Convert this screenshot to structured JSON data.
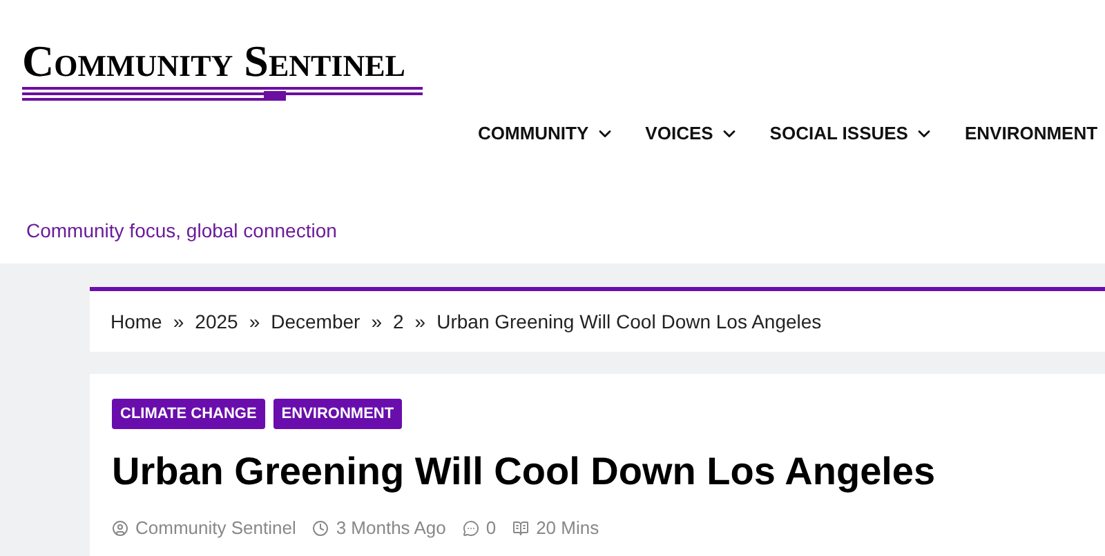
{
  "site": {
    "logo": "Community Sentinel",
    "tagline": "Community focus, global connection"
  },
  "nav": [
    {
      "label": "COMMUNITY",
      "dropdown": true
    },
    {
      "label": "VOICES",
      "dropdown": true
    },
    {
      "label": "SOCIAL ISSUES",
      "dropdown": true
    },
    {
      "label": "ENVIRONMENT",
      "dropdown": false
    }
  ],
  "breadcrumb": {
    "separator": "»",
    "items": [
      "Home",
      "2025",
      "December",
      "2",
      "Urban Greening Will Cool Down Los Angeles"
    ]
  },
  "article": {
    "tags": [
      "CLIMATE CHANGE",
      "ENVIRONMENT"
    ],
    "title": "Urban Greening Will Cool Down Los Angeles",
    "meta": [
      {
        "kind": "author",
        "text": "Community Sentinel"
      },
      {
        "kind": "time",
        "text": "3 Months Ago"
      },
      {
        "kind": "comments",
        "text": "0"
      },
      {
        "kind": "reading",
        "text": "20 Mins"
      }
    ]
  }
}
